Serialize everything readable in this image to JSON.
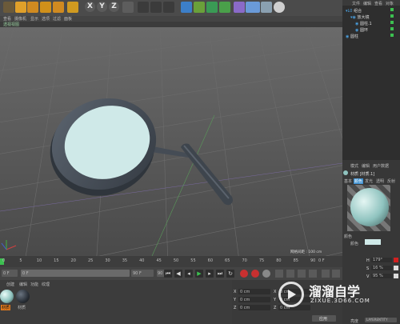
{
  "toolbar": {
    "axis_x": "X",
    "axis_y": "Y",
    "axis_z": "Z"
  },
  "viewport": {
    "menu": [
      "查看",
      "摄像机",
      "显示",
      "选项",
      "过滤",
      "面板"
    ],
    "tab_label": "透视视图",
    "grid_spacing": "网格间距 : 100 cm"
  },
  "object_manager": {
    "menu": [
      "文件",
      "编辑",
      "查看",
      "对象"
    ],
    "items": [
      "组合",
      "放大镜",
      "圆柱.1",
      "圆环",
      "圆柱"
    ]
  },
  "timeline": {
    "ticks": [
      "0",
      "5",
      "10",
      "15",
      "20",
      "25",
      "30",
      "35",
      "40",
      "45",
      "50",
      "55",
      "60",
      "65",
      "70",
      "75",
      "80",
      "85",
      "90"
    ],
    "frame_end_right": "0 F"
  },
  "transport": {
    "start_field": "0 F",
    "mid_field": "0 F",
    "end_field": "90 F",
    "end_field2": "90 F"
  },
  "material_manager": {
    "menu": [
      "创建",
      "编辑",
      "功能",
      "纹理"
    ],
    "materials": [
      "材质",
      "材质"
    ]
  },
  "coordinates": {
    "rows": [
      {
        "axis": "X",
        "value": "0 cm",
        "axis2": "X",
        "value2": "0 cm"
      },
      {
        "axis": "Y",
        "value": "0 cm",
        "axis2": "Y",
        "value2": "0 cm"
      },
      {
        "axis": "Z",
        "value": "0 cm",
        "axis2": "Z",
        "value2": "0 cm"
      }
    ],
    "apply_button": "应用"
  },
  "attributes": {
    "menu": [
      "模式",
      "编辑",
      "用户数据"
    ],
    "title": "材质 [材质.1]",
    "tabs": [
      "基本",
      "颜色",
      "发光",
      "透明",
      "反射"
    ],
    "section": "颜色",
    "color_label": "颜色",
    "h_label": "H",
    "h_value": "179°",
    "s_label": "S",
    "s_value": "16 %",
    "v_label": "V",
    "v_value": "95 %",
    "bottom_label": "亮度",
    "bottom_value": "LAYERENTITY"
  },
  "watermark": {
    "brand": "溜溜自学",
    "url": "ZIXUE.3D66.COM"
  },
  "colors": {
    "lens": "#cfe9e8",
    "sphere": "#8fc3bf",
    "accent_orange": "#e07a1e",
    "accent_blue": "#3c8fd0"
  }
}
